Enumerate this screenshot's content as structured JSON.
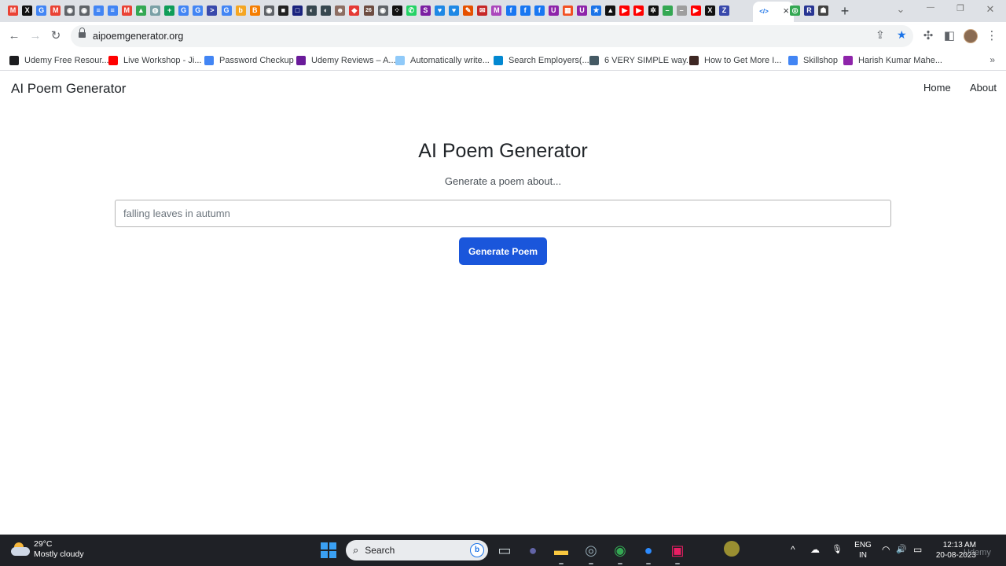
{
  "browser": {
    "tabs": [
      {
        "icon": "gmail-icon",
        "glyph": "M",
        "color": "#ea4335"
      },
      {
        "icon": "x-icon",
        "glyph": "X",
        "color": "#111111"
      },
      {
        "icon": "google-icon",
        "glyph": "G",
        "color": "#4285f4"
      },
      {
        "icon": "gmail-icon",
        "glyph": "M",
        "color": "#ea4335"
      },
      {
        "icon": "globe-icon",
        "glyph": "◉",
        "color": "#5f6368"
      },
      {
        "icon": "globe-icon",
        "glyph": "◉",
        "color": "#5f6368"
      },
      {
        "icon": "docs-icon",
        "glyph": "≡",
        "color": "#4285f4"
      },
      {
        "icon": "docs-icon",
        "glyph": "≡",
        "color": "#4285f4"
      },
      {
        "icon": "gmail-icon",
        "glyph": "M",
        "color": "#ea4335"
      },
      {
        "icon": "drive-icon",
        "glyph": "▲",
        "color": "#34a853"
      },
      {
        "icon": "app-icon",
        "glyph": "◍",
        "color": "#7aa0a6"
      },
      {
        "icon": "sheets-icon",
        "glyph": "+",
        "color": "#0f9d58"
      },
      {
        "icon": "google-icon",
        "glyph": "G",
        "color": "#4285f4"
      },
      {
        "icon": "google-icon",
        "glyph": "G",
        "color": "#4285f4"
      },
      {
        "icon": "terminal-icon",
        "glyph": ">",
        "color": "#3949ab"
      },
      {
        "icon": "google-icon",
        "glyph": "G",
        "color": "#4285f4"
      },
      {
        "icon": "app-icon",
        "glyph": "b",
        "color": "#f5a623"
      },
      {
        "icon": "blogger-icon",
        "glyph": "B",
        "color": "#f57d00"
      },
      {
        "icon": "globe-icon",
        "glyph": "◉",
        "color": "#5f6368"
      },
      {
        "icon": "app-icon",
        "glyph": "■",
        "color": "#222222"
      },
      {
        "icon": "app-icon",
        "glyph": "□",
        "color": "#1a237e"
      },
      {
        "icon": "app-icon",
        "glyph": "◐",
        "color": "#37474f"
      },
      {
        "icon": "app-icon",
        "glyph": "◐",
        "color": "#37474f"
      },
      {
        "icon": "person-icon",
        "glyph": "☻",
        "color": "#8d6e63"
      },
      {
        "icon": "app-icon",
        "glyph": "◆",
        "color": "#e53935"
      },
      {
        "icon": "app-icon",
        "glyph": "26",
        "color": "#6d4c41"
      },
      {
        "icon": "globe-icon",
        "glyph": "◉",
        "color": "#5f6368"
      },
      {
        "icon": "app-icon",
        "glyph": "⁘",
        "color": "#111111"
      },
      {
        "icon": "whatsapp-icon",
        "glyph": "✆",
        "color": "#25d366"
      },
      {
        "icon": "app-icon",
        "glyph": "S",
        "color": "#7b1fa2"
      },
      {
        "icon": "chat-icon",
        "glyph": "♥",
        "color": "#1e88e5"
      },
      {
        "icon": "chat-icon",
        "glyph": "♥",
        "color": "#1e88e5"
      },
      {
        "icon": "app-icon",
        "glyph": "✎",
        "color": "#e65100"
      },
      {
        "icon": "app-icon",
        "glyph": "✉",
        "color": "#c62828"
      },
      {
        "icon": "app-icon",
        "glyph": "M",
        "color": "#ab47bc"
      },
      {
        "icon": "facebook-icon",
        "glyph": "f",
        "color": "#1877f2"
      },
      {
        "icon": "facebook-icon",
        "glyph": "f",
        "color": "#1877f2"
      },
      {
        "icon": "facebook-icon",
        "glyph": "f",
        "color": "#1877f2"
      },
      {
        "icon": "app-icon",
        "glyph": "U",
        "color": "#8e24aa"
      },
      {
        "icon": "microsoft-icon",
        "glyph": "▦",
        "color": "#f25022"
      },
      {
        "icon": "app-icon",
        "glyph": "U",
        "color": "#8e24aa"
      },
      {
        "icon": "star-icon",
        "glyph": "★",
        "color": "#1a73e8"
      },
      {
        "icon": "app-icon",
        "glyph": "▲",
        "color": "#111111"
      },
      {
        "icon": "youtube-icon",
        "glyph": "▶",
        "color": "#ff0000"
      },
      {
        "icon": "youtube-icon",
        "glyph": "▶",
        "color": "#ff0000"
      },
      {
        "icon": "openai-icon",
        "glyph": "✲",
        "color": "#111111"
      },
      {
        "icon": "app-icon",
        "glyph": "–",
        "color": "#34a853"
      },
      {
        "icon": "app-icon",
        "glyph": "–",
        "color": "#9e9e9e"
      },
      {
        "icon": "youtube-icon",
        "glyph": "▶",
        "color": "#ff0000"
      },
      {
        "icon": "x-icon",
        "glyph": "X",
        "color": "#111111"
      },
      {
        "icon": "app-icon",
        "glyph": "Z",
        "color": "#3949ab"
      }
    ],
    "active_tab": {
      "icon": "code-icon",
      "glyph": "</>",
      "color": "#1a73e8",
      "close": "×"
    },
    "trailing_tabs": [
      {
        "icon": "app-icon",
        "glyph": "◎",
        "color": "#34a853"
      },
      {
        "icon": "app-icon",
        "glyph": "R",
        "color": "#283593"
      },
      {
        "icon": "app-icon",
        "glyph": "☗",
        "color": "#424242"
      }
    ],
    "new_tab": "+",
    "window_controls": {
      "chevron": "⌄",
      "minimize": "—",
      "restore": "❐",
      "close": "✕"
    },
    "nav": {
      "back": "←",
      "forward": "→",
      "reload": "↻"
    },
    "url": "aipoemgenerator.org",
    "omnibox_icons": {
      "share": "⇪",
      "bookmark": "★",
      "extensions": "✣",
      "sidepanel": "◧",
      "menu": "⋮"
    }
  },
  "bookmarks": [
    {
      "label": "Udemy Free Resour...",
      "icon": "udemy-icon",
      "color": "#1c1d1f"
    },
    {
      "label": "Live Workshop - Ji...",
      "icon": "youtube-icon",
      "color": "#ff0000"
    },
    {
      "label": "Password Checkup",
      "icon": "google-icon",
      "color": "#4285f4"
    },
    {
      "label": "Udemy Reviews – A...",
      "icon": "app-icon",
      "color": "#6a1b9a"
    },
    {
      "label": "Automatically write...",
      "icon": "ai-icon",
      "color": "#90caf9"
    },
    {
      "label": "Search Employers(...",
      "icon": "globe-icon",
      "color": "#0288d1"
    },
    {
      "label": "6 VERY SIMPLE way...",
      "icon": "app-icon",
      "color": "#455a64"
    },
    {
      "label": "How to Get More I...",
      "icon": "app-icon",
      "color": "#3e2723"
    },
    {
      "label": "Skillshop",
      "icon": "google-icon",
      "color": "#4285f4"
    },
    {
      "label": "Harish Kumar Mahe...",
      "icon": "app-icon",
      "color": "#8e24aa"
    }
  ],
  "bookmarks_more": "»",
  "page": {
    "brand": "AI Poem Generator",
    "nav": {
      "home": "Home",
      "about": "About"
    },
    "title": "AI Poem Generator",
    "subtitle": "Generate a poem about...",
    "input_placeholder": "falling leaves in autumn",
    "button_label": "Generate Poem",
    "button_color": "#1a56db"
  },
  "taskbar": {
    "weather": {
      "temp": "29°C",
      "condition": "Mostly cloudy"
    },
    "search_label": "Search",
    "search_icon": "⌕",
    "bing_glyph": "b",
    "apps": [
      {
        "icon": "file-explorer-view-icon",
        "glyph": "▭",
        "color": "#cfd8dc"
      },
      {
        "icon": "teams-icon",
        "glyph": "●",
        "color": "#6264a7"
      },
      {
        "icon": "folder-icon",
        "glyph": "▬",
        "color": "#f9c840"
      },
      {
        "icon": "app-icon",
        "glyph": "◎",
        "color": "#90a4ae"
      },
      {
        "icon": "chrome-icon",
        "glyph": "◉",
        "color": "#34a853"
      },
      {
        "icon": "zoom-icon",
        "glyph": "●",
        "color": "#2d8cff"
      },
      {
        "icon": "app-icon",
        "glyph": "▣",
        "color": "#e91e63"
      }
    ],
    "tray": {
      "chevron": "^",
      "cloud": "☁",
      "mic": "🎙",
      "wifi": "◠",
      "volume": "🔊",
      "battery": "▭"
    },
    "lang": {
      "line1": "ENG",
      "line2": "IN"
    },
    "clock": {
      "time": "12:13 AM",
      "date": "20-08-2023"
    },
    "watermark": "Udemy"
  }
}
